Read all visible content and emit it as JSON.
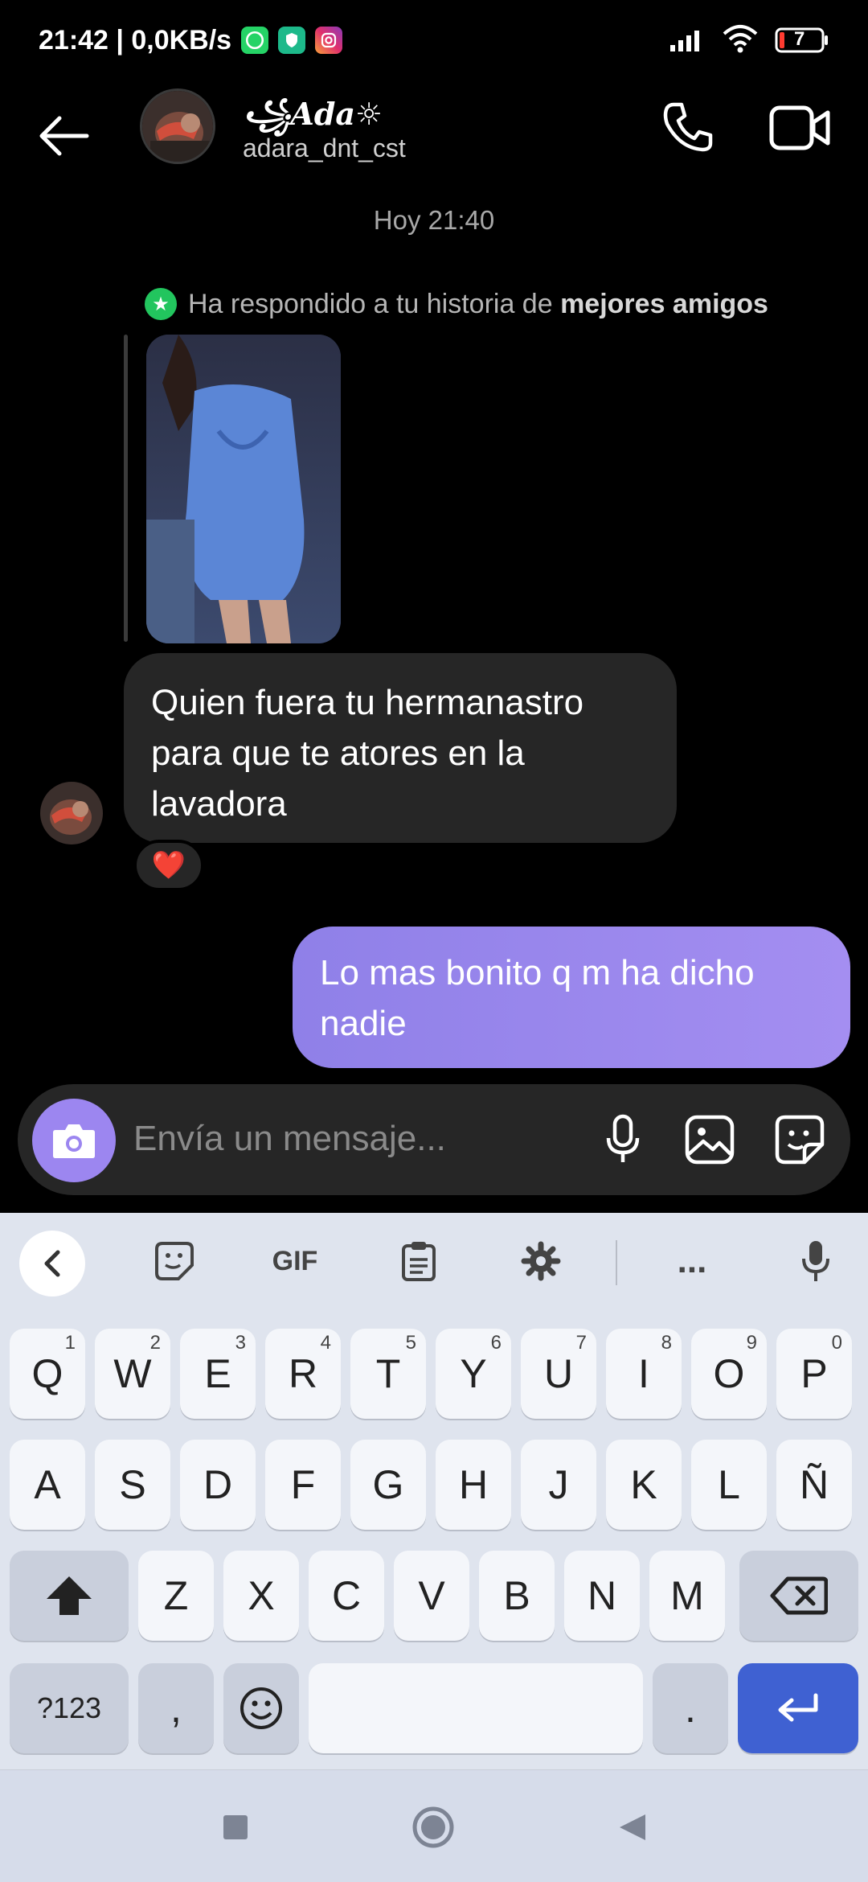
{
  "status_bar": {
    "time_speed": "21:42 | 0,0KB/s",
    "battery": "7"
  },
  "header": {
    "display_name": "꧁Ada☼",
    "username": "adara_dnt_cst"
  },
  "thread": {
    "time_separator": "Hoy 21:40",
    "reply_note_prefix": "Ha respondido a tu historia de",
    "reply_note_bold": "mejores amigos",
    "incoming_message": "Quien fuera tu hermanastro para que te atores en la lavadora",
    "reaction": "❤️",
    "outgoing_message": "Lo mas bonito q m ha dicho nadie"
  },
  "composer": {
    "placeholder": "Envía un mensaje..."
  },
  "keyboard": {
    "toolbar": {
      "gif_label": "GIF",
      "more_label": "..."
    },
    "row1": [
      {
        "k": "Q",
        "h": "1"
      },
      {
        "k": "W",
        "h": "2"
      },
      {
        "k": "E",
        "h": "3"
      },
      {
        "k": "R",
        "h": "4"
      },
      {
        "k": "T",
        "h": "5"
      },
      {
        "k": "Y",
        "h": "6"
      },
      {
        "k": "U",
        "h": "7"
      },
      {
        "k": "I",
        "h": "8"
      },
      {
        "k": "O",
        "h": "9"
      },
      {
        "k": "P",
        "h": "0"
      }
    ],
    "row2": [
      "A",
      "S",
      "D",
      "F",
      "G",
      "H",
      "J",
      "K",
      "L",
      "Ñ"
    ],
    "row3": [
      "Z",
      "X",
      "C",
      "V",
      "B",
      "N",
      "M"
    ],
    "bottom": {
      "symbols_label": "?123",
      "comma_label": ",",
      "period_label": "."
    }
  },
  "colors": {
    "accent": "#9c86f0",
    "outgoing_bubble": "#a48ef1",
    "incoming_bubble": "#262626",
    "enter_key": "#3f61d2",
    "close_friends_green": "#22c55e"
  }
}
